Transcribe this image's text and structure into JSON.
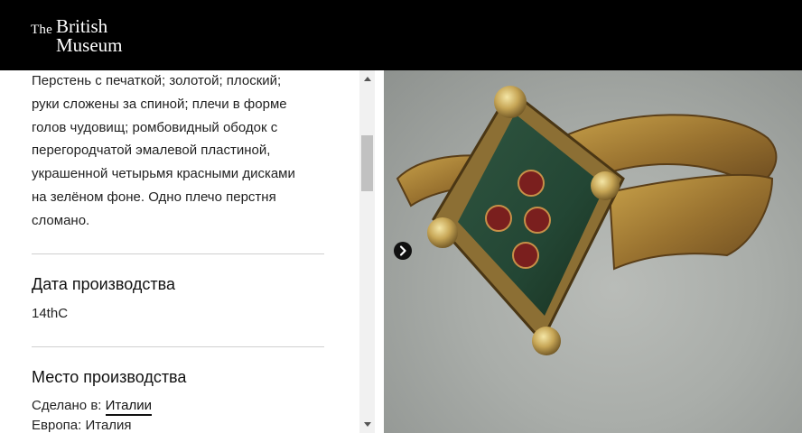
{
  "header": {
    "logo_the": "The",
    "logo_british": "British",
    "logo_museum": "Museum"
  },
  "details": {
    "description_lines": [
      "Перстень с печаткой; золотой; плоский;",
      "руки сложены за спиной; плечи в форме",
      "голов чудовищ; ромбовидный ободок с",
      "перегородчатой эмалевой пластиной,",
      "украшенной четырьмя красными дисками",
      "на зелёном фоне. Одно плечо перстня",
      "сломано."
    ],
    "production_date_title": "Дата производства",
    "production_date_value": "14thC",
    "production_place_title": "Место производства",
    "made_in_label": "Сделано в:",
    "made_in_link": "Италии",
    "region_label": "Европа:",
    "region_value": "Италия"
  },
  "image": {
    "icon": "chevron-right-icon",
    "accent": "#000000"
  }
}
